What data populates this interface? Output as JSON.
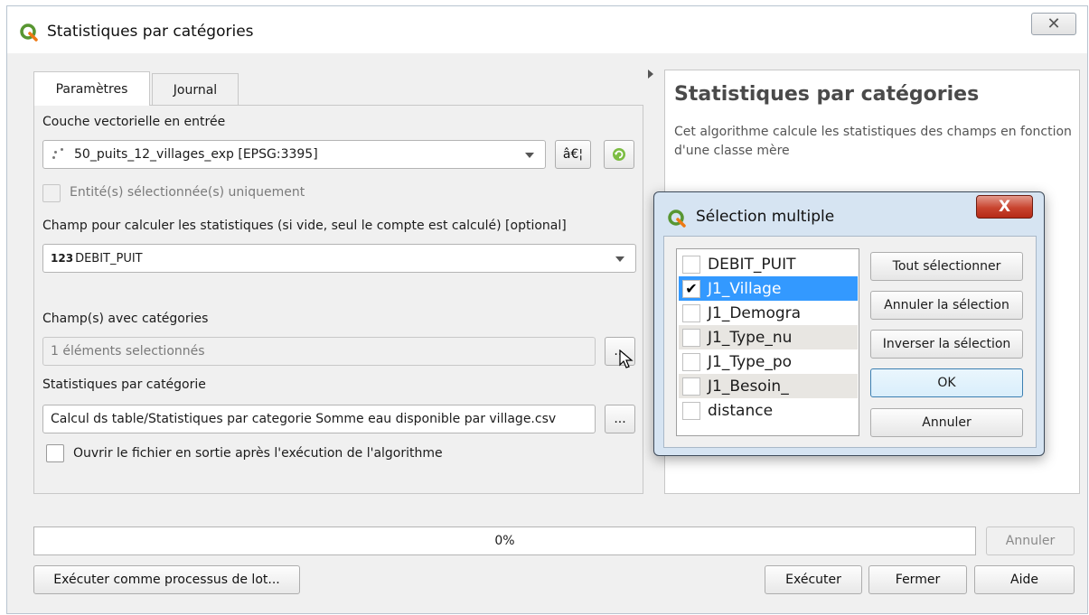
{
  "window": {
    "title": "Statistiques par catégories",
    "close_glyph": "✕"
  },
  "tabs": [
    {
      "label": "Paramètres"
    },
    {
      "label": "Journal"
    }
  ],
  "params": {
    "input_layer_label": "Couche vectorielle en entrée",
    "input_layer_value": "50_puits_12_villages_exp [EPSG:3395]",
    "input_layer_more": "â€¦",
    "selected_only_label": "Entité(s) sélectionnée(s) uniquement",
    "stat_field_label": "Champ pour calculer les statistiques (si vide, seul le compte est calculé) [optional]",
    "stat_field_type": "123",
    "stat_field_value": "DEBIT_PUIT",
    "category_fields_label": "Champ(s) avec catégories",
    "category_fields_value": "1 éléments selectionnés",
    "category_fields_more": "...",
    "output_label": "Statistiques par catégorie",
    "output_value": "Calcul ds table/Statistiques par categorie Somme eau disponible par village.csv",
    "output_more": "...",
    "open_output_label": "Ouvrir le fichier en sortie après l'exécution de l'algorithme"
  },
  "help": {
    "title": "Statistiques par catégories",
    "description": "Cet algorithme calcule les statistiques des champs en fonction d'une classe mère"
  },
  "progress": {
    "text": "0%",
    "value": 0,
    "cancel_label": "Annuler"
  },
  "footer": {
    "batch_label": "Exécuter comme processus de lot...",
    "run_label": "Exécuter",
    "close_label": "Fermer",
    "help_label": "Aide"
  },
  "multi_select": {
    "title": "Sélection multiple",
    "close_glyph": "X",
    "items": [
      {
        "label": "DEBIT_PUIT",
        "checked": false
      },
      {
        "label": "J1_Village",
        "checked": true
      },
      {
        "label": "J1_Demogra",
        "checked": false
      },
      {
        "label": "J1_Type_nu",
        "checked": false
      },
      {
        "label": "J1_Type_po",
        "checked": false
      },
      {
        "label": "J1_Besoin_",
        "checked": false
      },
      {
        "label": "distance",
        "checked": false
      }
    ],
    "check_glyph": "✔",
    "select_all_label": "Tout sélectionner",
    "clear_selection_label": "Annuler la sélection",
    "invert_selection_label": "Inverser la sélection",
    "ok_label": "OK",
    "cancel_label": "Annuler"
  },
  "colors": {
    "selection": "#3399ff",
    "qgis_green": "#589632",
    "qgis_yellow": "#ee7913"
  }
}
